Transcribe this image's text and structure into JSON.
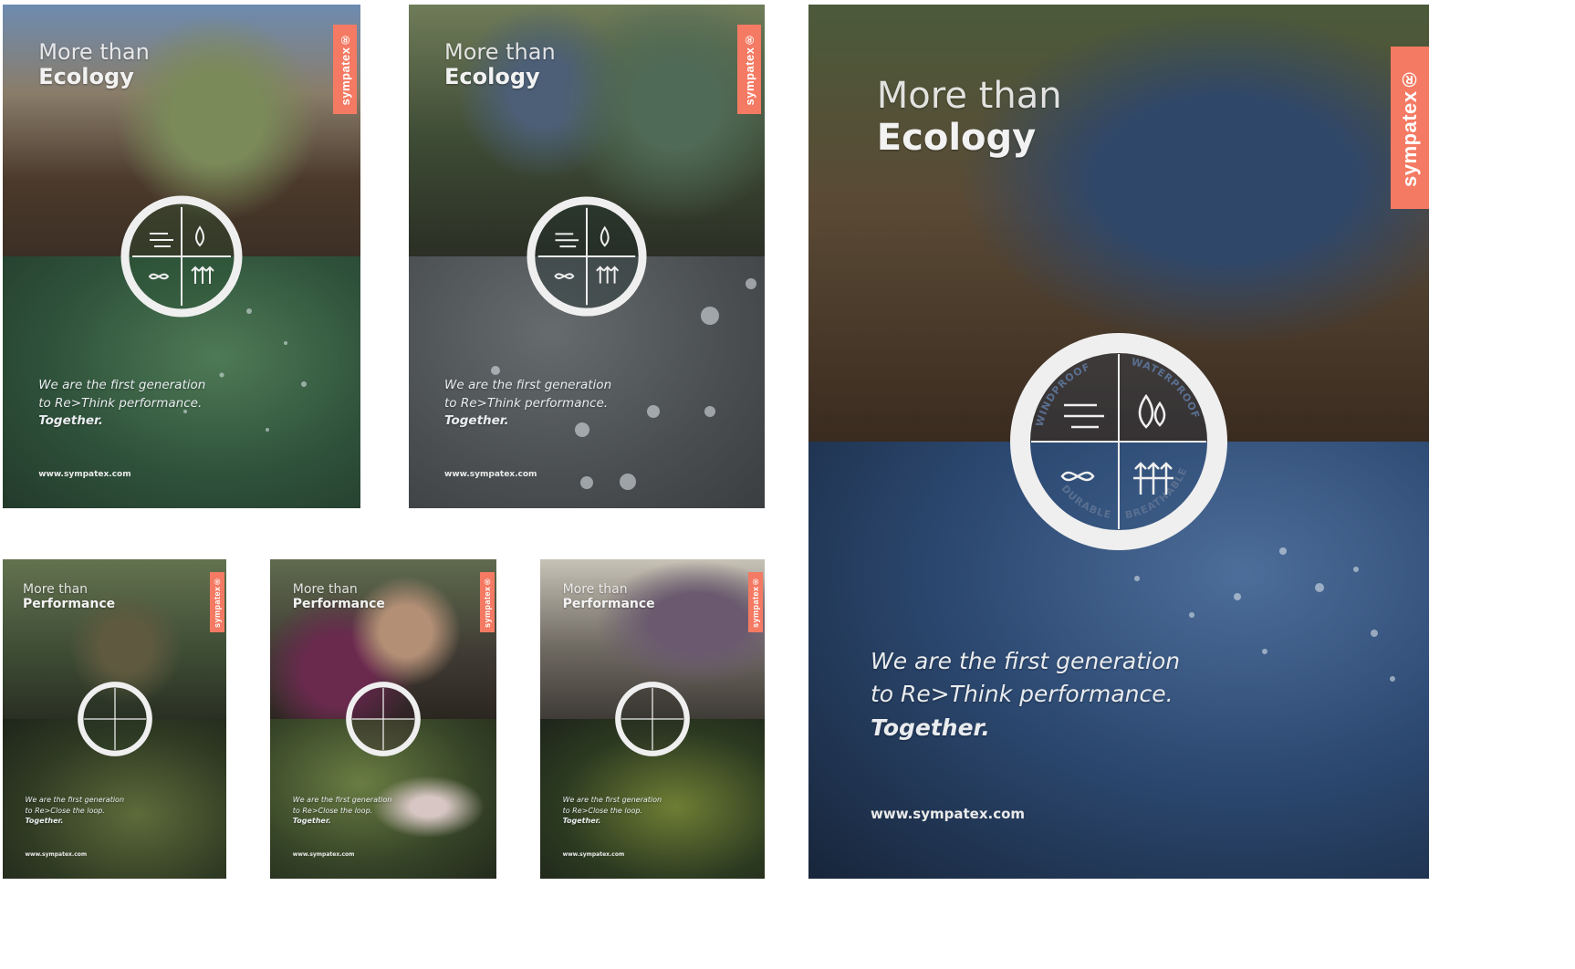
{
  "brand": {
    "name": "sympatex",
    "registered_mark": "®",
    "accent_color": "#f47a63"
  },
  "posters": [
    {
      "headline_line1": "More than",
      "headline_line2": "Ecology",
      "copy_line1": "We are the first generation",
      "copy_line2": "to Re>Think performance.",
      "copy_line3": "Together.",
      "url": "www.sympatex.com"
    },
    {
      "headline_line1": "More than",
      "headline_line2": "Ecology",
      "copy_line1": "We are the first generation",
      "copy_line2": "to Re>Think performance.",
      "copy_line3": "Together.",
      "url": "www.sympatex.com"
    },
    {
      "headline_line1": "More than",
      "headline_line2": "Ecology",
      "copy_line1": "We are the first generation",
      "copy_line2": "to Re>Think performance.",
      "copy_line3": "Together.",
      "url": "www.sympatex.com",
      "emblem_labels": {
        "top_left": "WINDPROOF",
        "top_right": "WATERPROOF",
        "bottom_left": "DURABLE",
        "bottom_right": "BREATHABLE"
      }
    },
    {
      "headline_line1": "More than",
      "headline_line2": "Performance",
      "copy_line1": "We are the first generation",
      "copy_line2": "to Re>Close the loop.",
      "copy_line3": "Together.",
      "url": "www.sympatex.com"
    },
    {
      "headline_line1": "More than",
      "headline_line2": "Performance",
      "copy_line1": "We are the first generation",
      "copy_line2": "to Re>Close the loop.",
      "copy_line3": "Together.",
      "url": "www.sympatex.com"
    },
    {
      "headline_line1": "More than",
      "headline_line2": "Performance",
      "copy_line1": "We are the first generation",
      "copy_line2": "to Re>Close the loop.",
      "copy_line3": "Together.",
      "url": "www.sympatex.com"
    }
  ]
}
